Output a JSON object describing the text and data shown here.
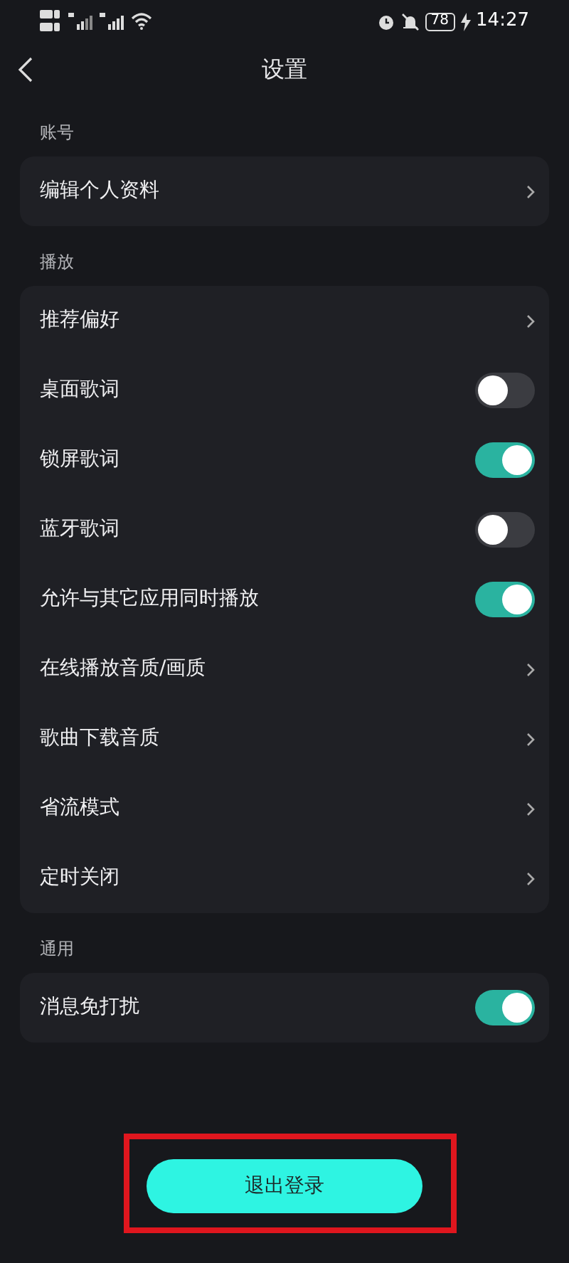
{
  "status_bar": {
    "battery": "78",
    "time": "14:27"
  },
  "header": {
    "title": "设置"
  },
  "sections": [
    {
      "title": "账号",
      "items": [
        {
          "label": "编辑个人资料",
          "kind": "link"
        }
      ]
    },
    {
      "title": "播放",
      "items": [
        {
          "label": "推荐偏好",
          "kind": "link"
        },
        {
          "label": "桌面歌词",
          "kind": "toggle",
          "on": false
        },
        {
          "label": "锁屏歌词",
          "kind": "toggle",
          "on": true
        },
        {
          "label": "蓝牙歌词",
          "kind": "toggle",
          "on": false
        },
        {
          "label": "允许与其它应用同时播放",
          "kind": "toggle",
          "on": true
        },
        {
          "label": "在线播放音质/画质",
          "kind": "link"
        },
        {
          "label": "歌曲下载音质",
          "kind": "link"
        },
        {
          "label": "省流模式",
          "kind": "link"
        },
        {
          "label": "定时关闭",
          "kind": "link"
        }
      ]
    },
    {
      "title": "通用",
      "items": [
        {
          "label": "消息免打扰",
          "kind": "toggle",
          "on": true
        }
      ]
    }
  ],
  "logout_button": {
    "label": "退出登录",
    "highlighted": true
  }
}
